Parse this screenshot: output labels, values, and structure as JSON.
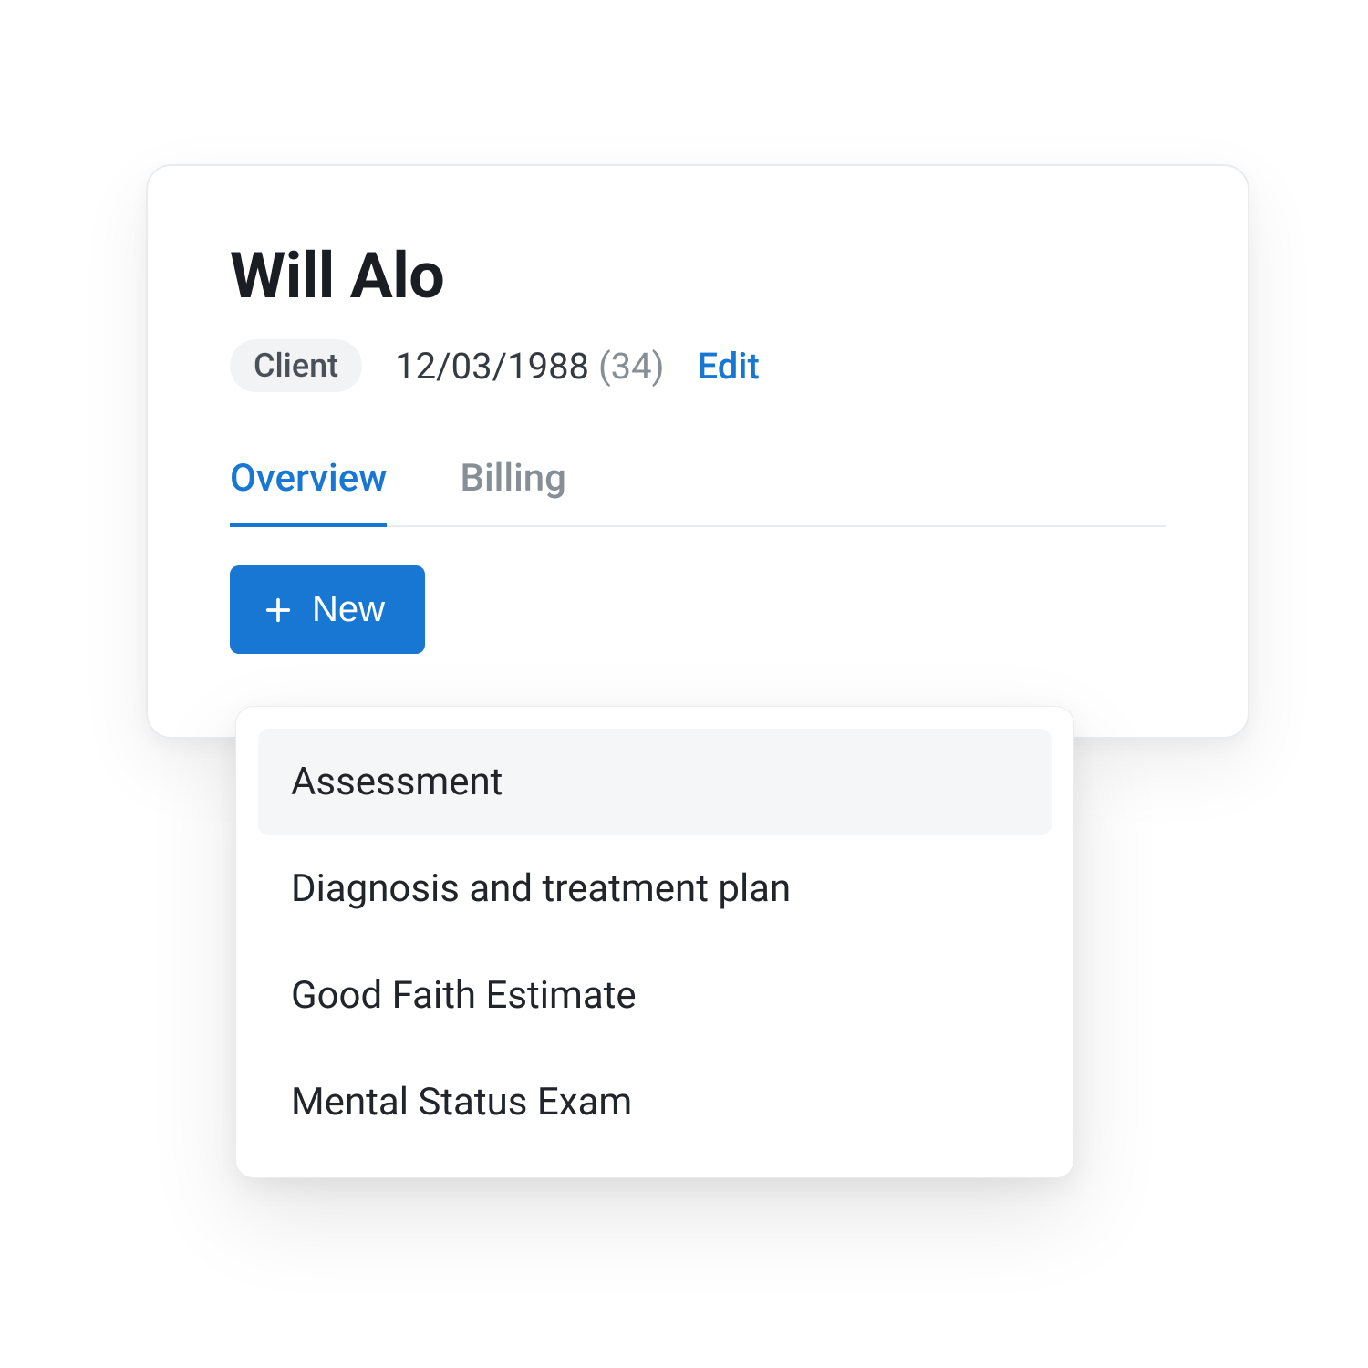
{
  "client": {
    "name": "Will Alo",
    "badge": "Client",
    "dob": "12/03/1988",
    "age": "(34)",
    "edit_label": "Edit"
  },
  "tabs": {
    "overview": "Overview",
    "billing": "Billing",
    "active": "overview"
  },
  "actions": {
    "new_label": "New"
  },
  "menu": {
    "items": [
      "Assessment",
      "Diagnosis and treatment plan",
      "Good Faith Estimate",
      "Mental Status Exam"
    ],
    "hover_index": 0
  },
  "colors": {
    "accent": "#1877d3",
    "text": "#212529",
    "muted": "#868e96",
    "badge_bg": "#f1f3f5",
    "border": "#e9ecef"
  }
}
